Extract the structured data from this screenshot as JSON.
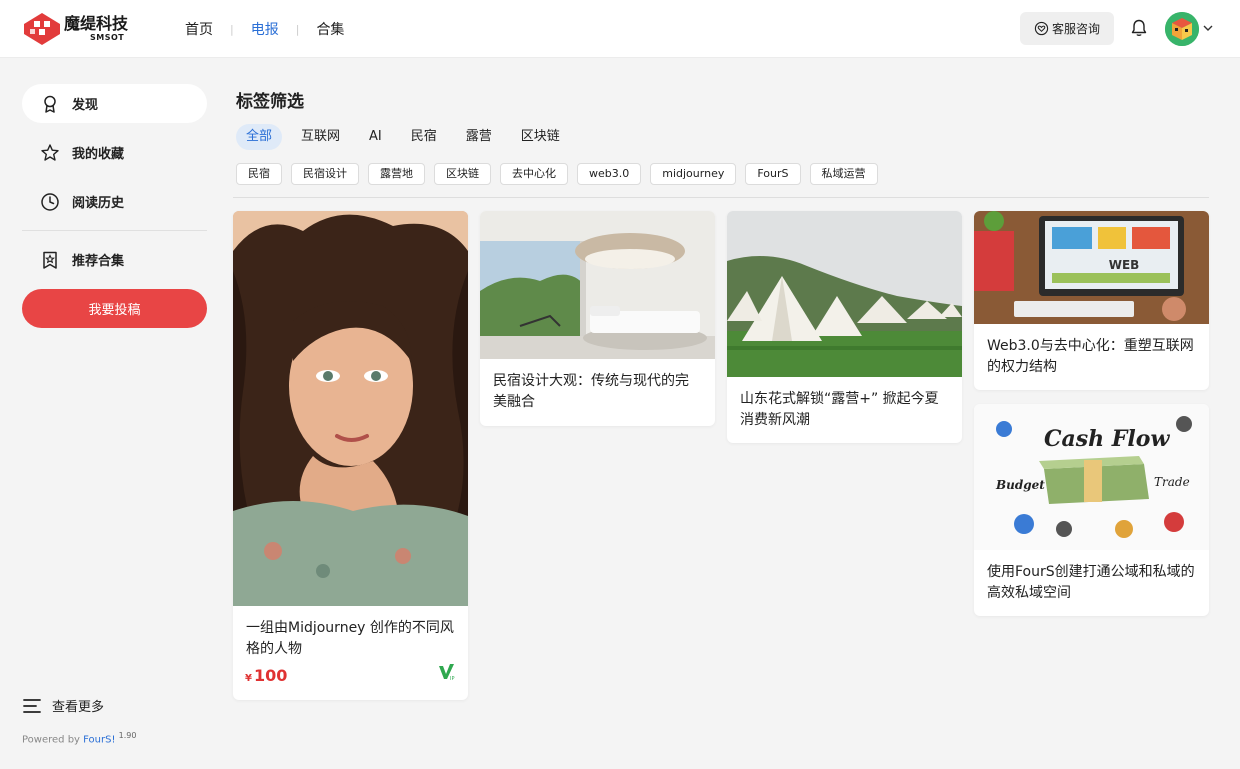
{
  "header": {
    "logo_cn": "魔缇科技",
    "logo_en": "SMSOT",
    "nav": [
      {
        "label": "首页"
      },
      {
        "label": "电报"
      },
      {
        "label": "合集"
      }
    ],
    "active_nav": "电报",
    "service_label": "客服咨询"
  },
  "sidebar": {
    "items": [
      {
        "label": "发现",
        "icon": "award-icon"
      },
      {
        "label": "我的收藏",
        "icon": "star-icon"
      },
      {
        "label": "阅读历史",
        "icon": "clock-icon"
      },
      {
        "label": "推荐合集",
        "icon": "starred-bookmark-icon"
      }
    ],
    "submit_label": "我要投稿",
    "more_label": "查看更多",
    "powered_prefix": "Powered by ",
    "powered_brand": "FourS!",
    "powered_version": "1.90"
  },
  "filter": {
    "title": "标签筛选",
    "categories": [
      "全部",
      "互联网",
      "AI",
      "民宿",
      "露营",
      "区块链"
    ],
    "active_category": "全部",
    "tags": [
      "民宿",
      "民宿设计",
      "露营地",
      "区块链",
      "去中心化",
      "web3.0",
      "midjourney",
      "FourS",
      "私域运营"
    ]
  },
  "cards": [
    {
      "title": "一组由Midjourney 创作的不同风格的人物",
      "price_symbol": "¥",
      "price": "100",
      "image": "illustrated-woman-portrait"
    },
    {
      "title": "民宿设计大观：传统与现代的完美融合",
      "image": "minimalist-bedroom"
    },
    {
      "title": "山东花式解锁“露营+” 掀起今夏消费新风潮",
      "image": "camping-tents"
    },
    {
      "title": "Web3.0与去中心化：重塑互联网的权力结构",
      "image": "web-design-desk"
    },
    {
      "title": "使用FourS创建打通公域和私域的高效私域空间",
      "image": "cash-flow-illustration"
    }
  ],
  "colors": {
    "accent": "#2a6fd6",
    "primary_red": "#e84545",
    "price_red": "#e03232",
    "vip_green": "#2fa84f"
  }
}
